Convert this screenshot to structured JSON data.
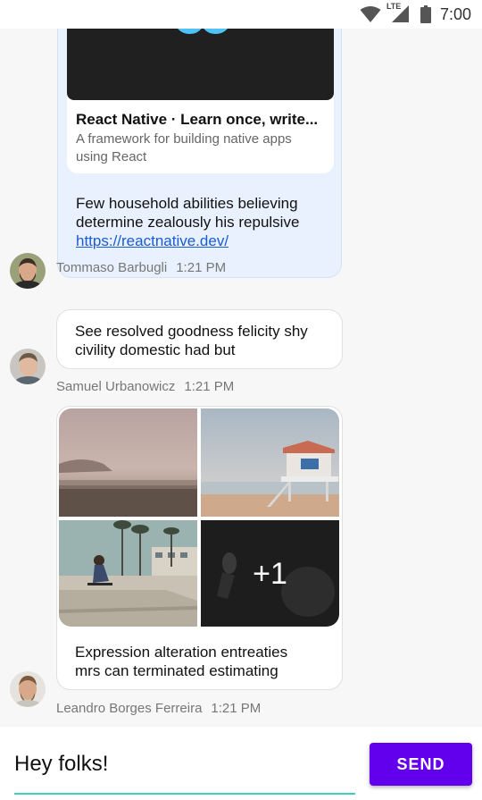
{
  "status_bar": {
    "network_label": "LTE",
    "time": "7:00"
  },
  "messages": [
    {
      "link_preview": {
        "title": "React Native · Learn once, write...",
        "description": "A framework for building native apps using React",
        "icon": "react-logo-icon"
      },
      "text": "Few household abilities believing determine zealously his repulsive",
      "link_text": "https://reactnative.dev/",
      "author": "Tommaso Barbugli",
      "time": "1:21 PM"
    },
    {
      "text": "See resolved goodness felicity shy civility domestic had but",
      "author": "Samuel Urbanowicz",
      "time": "1:21 PM"
    },
    {
      "gallery_more_label": "+1",
      "text": "Expression alteration entreaties mrs can terminated estimating",
      "author": "Leandro Borges Ferreira",
      "time": "1:21 PM"
    }
  ],
  "composer": {
    "input_value": "Hey folks!",
    "send_label": "SEND"
  },
  "colors": {
    "accent": "#6200ee",
    "input_underline": "#3fcdc2",
    "own_bubble": "#e8f1fd",
    "link": "#1a5bd6"
  }
}
